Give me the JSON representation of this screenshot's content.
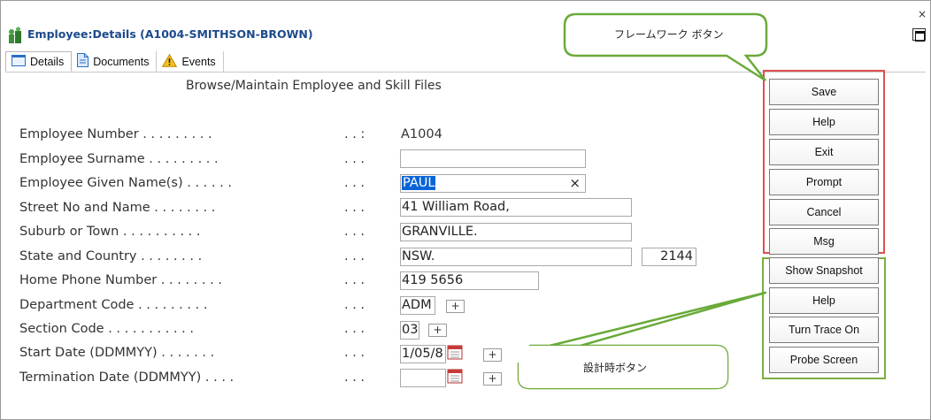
{
  "window": {
    "title": "Employee:Details (A1004-SMITHSON-BROWN)",
    "close_glyph": "×"
  },
  "tabs": [
    {
      "label": "Details",
      "icon": "details-form-icon",
      "active": true
    },
    {
      "label": "Documents",
      "icon": "document-icon",
      "active": false
    },
    {
      "label": "Events",
      "icon": "warning-icon",
      "active": false
    }
  ],
  "form": {
    "subtitle": "Browse/Maintain Employee and Skill Files",
    "rows": [
      {
        "label": "Employee Number . . . . . . . . .",
        "dots": ". . :",
        "value": "A1004"
      },
      {
        "label": "Employee Surname . . . . . . . . .",
        "dots": ". . .",
        "value": ""
      },
      {
        "label": "Employee Given Name(s) . . . . . .",
        "dots": ". . .",
        "value": "PAUL"
      },
      {
        "label": "Street No and Name . . . . . . . .",
        "dots": ". . .",
        "value": "41 William Road,"
      },
      {
        "label": "Suburb or Town . . . . . . . . . .",
        "dots": ". . .",
        "value": "GRANVILLE."
      },
      {
        "label": "State and Country  . . . . . . . .",
        "dots": ". . .",
        "value": "NSW.",
        "extra": "2144"
      },
      {
        "label": "Home Phone Number  . . . . . . . .",
        "dots": ". . .",
        "value": "419 5656"
      },
      {
        "label": "Department Code  . . . . . . . . .",
        "dots": ". . .",
        "value": "ADM"
      },
      {
        "label": "Section Code . . . . . . . . . . .",
        "dots": ". . .",
        "value": "03"
      },
      {
        "label": "Start Date (DDMMYY)  . . . . . . .",
        "dots": ". . .",
        "value": "1/05/8"
      },
      {
        "label": "Termination Date (DDMMYY)  . . . .",
        "dots": ". . .",
        "value": ""
      }
    ],
    "clear_glyph": "×",
    "plus_glyph": "+"
  },
  "framework_buttons": [
    "Save",
    "Help",
    "Exit",
    "Prompt",
    "Cancel",
    "Msg"
  ],
  "design_buttons": [
    "Show Snapshot",
    "Help",
    "Turn Trace On",
    "Probe Screen"
  ],
  "callouts": {
    "framework": "フレームワーク ボタン",
    "design": "設計時ボタン"
  },
  "colors": {
    "title": "#1c4a8c",
    "selection": "#0a64d8",
    "framework_box": "#e05050",
    "design_box": "#78b040",
    "callout_border": "#6aaa3a"
  }
}
